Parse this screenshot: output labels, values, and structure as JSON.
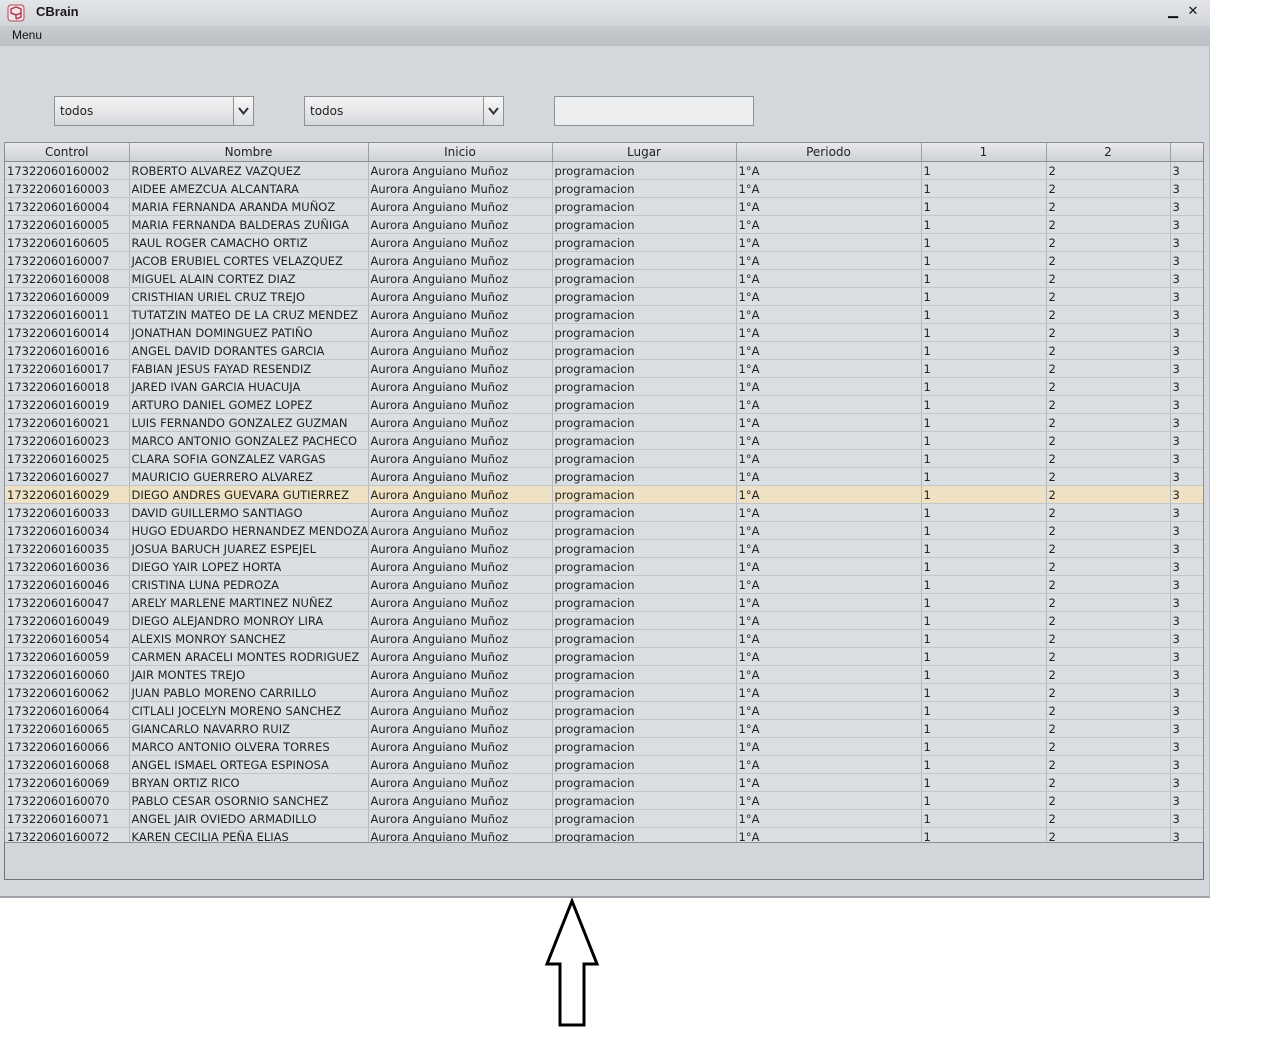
{
  "window": {
    "title": "CBrain",
    "minimize_glyph": "▁",
    "close_glyph": "✕"
  },
  "menu": {
    "items": [
      "Menu"
    ]
  },
  "filters": {
    "combo1_value": "todos",
    "combo2_value": "todos",
    "search_value": "",
    "search_placeholder": ""
  },
  "table": {
    "columns": [
      "Control",
      "Nombre",
      "Inicio",
      "Lugar",
      "Periodo",
      "1",
      "2",
      ""
    ],
    "selected_row_index": 18,
    "rows": [
      [
        "17322060160002",
        "ROBERTO ALVAREZ VAZQUEZ",
        "Aurora Anguiano Muñoz",
        "programacion",
        "1°A",
        "1",
        "2",
        "3"
      ],
      [
        "17322060160003",
        "AIDEE AMEZCUA ALCANTARA",
        "Aurora Anguiano Muñoz",
        "programacion",
        "1°A",
        "1",
        "2",
        "3"
      ],
      [
        "17322060160004",
        "MARIA FERNANDA ARANDA MUÑOZ",
        "Aurora Anguiano Muñoz",
        "programacion",
        "1°A",
        "1",
        "2",
        "3"
      ],
      [
        "17322060160005",
        "MARIA FERNANDA BALDERAS ZUÑIGA",
        "Aurora Anguiano Muñoz",
        "programacion",
        "1°A",
        "1",
        "2",
        "3"
      ],
      [
        "17322060160605",
        "RAUL ROGER CAMACHO ORTIZ",
        "Aurora Anguiano Muñoz",
        "programacion",
        "1°A",
        "1",
        "2",
        "3"
      ],
      [
        "17322060160007",
        "JACOB ERUBIEL CORTES VELAZQUEZ",
        "Aurora Anguiano Muñoz",
        "programacion",
        "1°A",
        "1",
        "2",
        "3"
      ],
      [
        "17322060160008",
        "MIGUEL ALAIN CORTEZ DIAZ",
        "Aurora Anguiano Muñoz",
        "programacion",
        "1°A",
        "1",
        "2",
        "3"
      ],
      [
        "17322060160009",
        "CRISTHIAN URIEL CRUZ TREJO",
        "Aurora Anguiano Muñoz",
        "programacion",
        "1°A",
        "1",
        "2",
        "3"
      ],
      [
        "17322060160011",
        "TUTATZIN MATEO DE LA CRUZ MENDEZ",
        "Aurora Anguiano Muñoz",
        "programacion",
        "1°A",
        "1",
        "2",
        "3"
      ],
      [
        "17322060160014",
        "JONATHAN DOMINGUEZ PATIÑO",
        "Aurora Anguiano Muñoz",
        "programacion",
        "1°A",
        "1",
        "2",
        "3"
      ],
      [
        "17322060160016",
        "ANGEL DAVID DORANTES GARCIA",
        "Aurora Anguiano Muñoz",
        "programacion",
        "1°A",
        "1",
        "2",
        "3"
      ],
      [
        "17322060160017",
        "FABIAN JESUS FAYAD RESENDIZ",
        "Aurora Anguiano Muñoz",
        "programacion",
        "1°A",
        "1",
        "2",
        "3"
      ],
      [
        "17322060160018",
        "JARED IVAN GARCIA HUACUJA",
        "Aurora Anguiano Muñoz",
        "programacion",
        "1°A",
        "1",
        "2",
        "3"
      ],
      [
        "17322060160019",
        "ARTURO DANIEL GOMEZ LOPEZ",
        "Aurora Anguiano Muñoz",
        "programacion",
        "1°A",
        "1",
        "2",
        "3"
      ],
      [
        "17322060160021",
        "LUIS FERNANDO GONZALEZ GUZMAN",
        "Aurora Anguiano Muñoz",
        "programacion",
        "1°A",
        "1",
        "2",
        "3"
      ],
      [
        "17322060160023",
        "MARCO ANTONIO GONZALEZ PACHECO",
        "Aurora Anguiano Muñoz",
        "programacion",
        "1°A",
        "1",
        "2",
        "3"
      ],
      [
        "17322060160025",
        "CLARA SOFIA GONZALEZ VARGAS",
        "Aurora Anguiano Muñoz",
        "programacion",
        "1°A",
        "1",
        "2",
        "3"
      ],
      [
        "17322060160027",
        "MAURICIO GUERRERO ALVAREZ",
        "Aurora Anguiano Muñoz",
        "programacion",
        "1°A",
        "1",
        "2",
        "3"
      ],
      [
        "17322060160029",
        "DIEGO ANDRES GUEVARA GUTIERREZ",
        "Aurora Anguiano Muñoz",
        "programacion",
        "1°A",
        "1",
        "2",
        "3"
      ],
      [
        "17322060160033",
        "DAVID GUILLERMO SANTIAGO",
        "Aurora Anguiano Muñoz",
        "programacion",
        "1°A",
        "1",
        "2",
        "3"
      ],
      [
        "17322060160034",
        "HUGO EDUARDO HERNANDEZ MENDOZA",
        "Aurora Anguiano Muñoz",
        "programacion",
        "1°A",
        "1",
        "2",
        "3"
      ],
      [
        "17322060160035",
        "JOSUA BARUCH JUAREZ ESPEJEL",
        "Aurora Anguiano Muñoz",
        "programacion",
        "1°A",
        "1",
        "2",
        "3"
      ],
      [
        "17322060160036",
        "DIEGO YAIR LOPEZ HORTA",
        "Aurora Anguiano Muñoz",
        "programacion",
        "1°A",
        "1",
        "2",
        "3"
      ],
      [
        "17322060160046",
        "CRISTINA LUNA PEDROZA",
        "Aurora Anguiano Muñoz",
        "programacion",
        "1°A",
        "1",
        "2",
        "3"
      ],
      [
        "17322060160047",
        "ARELY MARLENE MARTINEZ NUÑEZ",
        "Aurora Anguiano Muñoz",
        "programacion",
        "1°A",
        "1",
        "2",
        "3"
      ],
      [
        "17322060160049",
        "DIEGO ALEJANDRO MONROY LIRA",
        "Aurora Anguiano Muñoz",
        "programacion",
        "1°A",
        "1",
        "2",
        "3"
      ],
      [
        "17322060160054",
        "ALEXIS MONROY SANCHEZ",
        "Aurora Anguiano Muñoz",
        "programacion",
        "1°A",
        "1",
        "2",
        "3"
      ],
      [
        "17322060160059",
        "CARMEN ARACELI MONTES RODRIGUEZ",
        "Aurora Anguiano Muñoz",
        "programacion",
        "1°A",
        "1",
        "2",
        "3"
      ],
      [
        "17322060160060",
        "JAIR MONTES TREJO",
        "Aurora Anguiano Muñoz",
        "programacion",
        "1°A",
        "1",
        "2",
        "3"
      ],
      [
        "17322060160062",
        "JUAN PABLO MORENO CARRILLO",
        "Aurora Anguiano Muñoz",
        "programacion",
        "1°A",
        "1",
        "2",
        "3"
      ],
      [
        "17322060160064",
        "CITLALI JOCELYN MORENO SANCHEZ",
        "Aurora Anguiano Muñoz",
        "programacion",
        "1°A",
        "1",
        "2",
        "3"
      ],
      [
        "17322060160065",
        "GIANCARLO NAVARRO RUIZ",
        "Aurora Anguiano Muñoz",
        "programacion",
        "1°A",
        "1",
        "2",
        "3"
      ],
      [
        "17322060160066",
        "MARCO ANTONIO OLVERA TORRES",
        "Aurora Anguiano Muñoz",
        "programacion",
        "1°A",
        "1",
        "2",
        "3"
      ],
      [
        "17322060160068",
        "ANGEL ISMAEL ORTEGA ESPINOSA",
        "Aurora Anguiano Muñoz",
        "programacion",
        "1°A",
        "1",
        "2",
        "3"
      ],
      [
        "17322060160069",
        "BRYAN ORTIZ RICO",
        "Aurora Anguiano Muñoz",
        "programacion",
        "1°A",
        "1",
        "2",
        "3"
      ],
      [
        "17322060160070",
        "PABLO CESAR OSORNIO SANCHEZ",
        "Aurora Anguiano Muñoz",
        "programacion",
        "1°A",
        "1",
        "2",
        "3"
      ],
      [
        "17322060160071",
        "ANGEL JAIR OVIEDO ARMADILLO",
        "Aurora Anguiano Muñoz",
        "programacion",
        "1°A",
        "1",
        "2",
        "3"
      ],
      [
        "17322060160072",
        "KAREN CECILIA PEÑA ELIAS",
        "Aurora Anguiano Muñoz",
        "programacion",
        "1°A",
        "1",
        "2",
        "3"
      ]
    ]
  },
  "colors": {
    "selected_row": "#eee1c4",
    "window_bg": "#d4d7dc"
  },
  "icons": {
    "app": "cbrain-app-icon",
    "dropdown": "chevron-down-icon",
    "annotation": "up-arrow-icon"
  }
}
